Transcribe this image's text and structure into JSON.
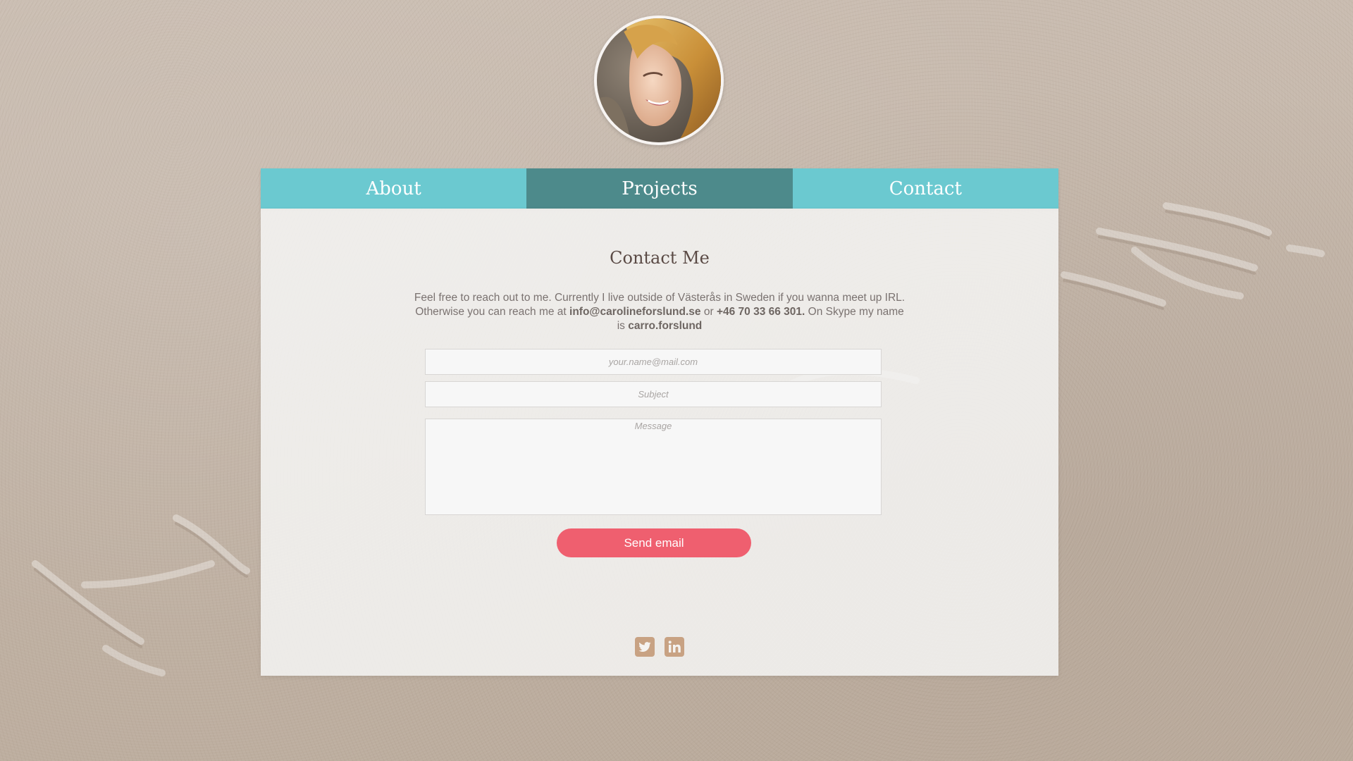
{
  "profile": {
    "avatar_alt": "Profile photo"
  },
  "nav": {
    "tabs": [
      {
        "label": "About",
        "active": false
      },
      {
        "label": "Projects",
        "active": true
      },
      {
        "label": "Contact",
        "active": false
      }
    ]
  },
  "contact": {
    "title": "Contact Me",
    "intro_part1": "Feel free to reach out to me. Currently I live outside of Västerås in Sweden if you wanna meet up IRL. Otherwise you can reach me at ",
    "email": "info@carolineforslund.se",
    "intro_part2": " or ",
    "phone": "+46 70 33 66 301.",
    "intro_part3": " On Skype my name is ",
    "skype": "carro.forslund",
    "form": {
      "email_placeholder": "your.name@mail.com",
      "subject_placeholder": "Subject",
      "message_placeholder": "Message",
      "send_label": "Send email"
    }
  },
  "social": {
    "items": [
      {
        "name": "twitter-icon"
      },
      {
        "name": "linkedin-icon"
      }
    ]
  },
  "colors": {
    "tab": "#6bc9d0",
    "tab_active": "#4d8a8b",
    "button": "#ef5f6f",
    "social_icon": "#c8a283"
  }
}
